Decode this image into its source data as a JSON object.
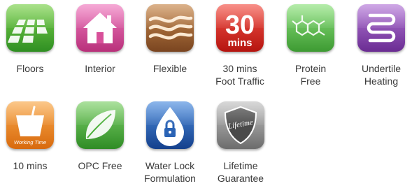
{
  "features": [
    {
      "line1": "Floors",
      "line2": "",
      "icon": "floor-tiles-icon",
      "color": "#4caf3a"
    },
    {
      "line1": "Interior",
      "line2": "",
      "icon": "house-icon",
      "color": "#d8509a"
    },
    {
      "line1": "Flexible",
      "line2": "",
      "icon": "wavy-lines-icon",
      "color": "#9a5b2e"
    },
    {
      "line1": "30 mins",
      "line2": "Foot Traffic",
      "icon": "30-mins-icon",
      "color": "#e3261d",
      "badge_number": "30",
      "badge_unit": "mins"
    },
    {
      "line1": "Protein",
      "line2": "Free",
      "icon": "molecule-icon",
      "color": "#62c35a"
    },
    {
      "line1": "Undertile",
      "line2": "Heating",
      "icon": "heating-coil-icon",
      "color": "#8b4bb0"
    },
    {
      "line1": "10 mins",
      "line2": "",
      "icon": "bucket-icon",
      "color": "#ee8520",
      "badge_text": "Working Time"
    },
    {
      "line1": "OPC Free",
      "line2": "",
      "icon": "leaf-icon",
      "color": "#56b548"
    },
    {
      "line1": "Water Lock",
      "line2": "Formulation",
      "icon": "water-drop-lock-icon",
      "color": "#2a63b5"
    },
    {
      "line1": "Lifetime",
      "line2": "Guarantee",
      "icon": "shield-icon",
      "color": "#8f8f8f",
      "badge_text": "Lifetime"
    }
  ]
}
